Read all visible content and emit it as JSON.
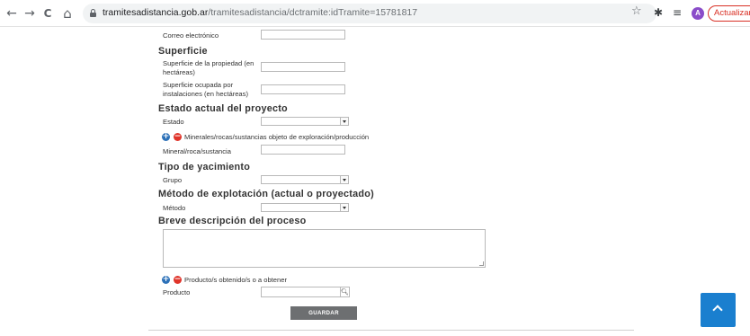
{
  "browser": {
    "url_host": "tramitesadistancia.gob.ar",
    "url_path": "/tramitesadistancia/dctramite:idTramite=15781817",
    "avatar_letter": "A",
    "update_label": "Actualizar",
    "back_icon": "←",
    "forward_icon": "→",
    "reload_icon": "C",
    "home_icon": "⌂"
  },
  "form": {
    "correo_label": "Correo electrónico",
    "superficie_title": "Superficie",
    "sup_propiedad_label_1": "Superficie de la propiedad (en",
    "sup_propiedad_label_2": "hectáreas)",
    "sup_ocupada_label_1": "Superficie ocupada por",
    "sup_ocupada_label_2": "instalaciones (en hectáreas)",
    "estado_title": "Estado actual del proyecto",
    "estado_label": "Estado",
    "minerales_label": "Minerales/rocas/sustancias objeto de exploración/producción",
    "mineral_label": "Mineral/roca/sustancia",
    "yacimiento_title": "Tipo de yacimiento",
    "grupo_label": "Grupo",
    "metodo_title": "Método de explotación (actual o proyectado)",
    "metodo_label": "Método",
    "descripcion_title": "Breve descripción del proceso",
    "productos_label": "Producto/s obtenido/s o a obtener",
    "producto_label": "Producto",
    "guardar_label": "GUARDAR"
  }
}
